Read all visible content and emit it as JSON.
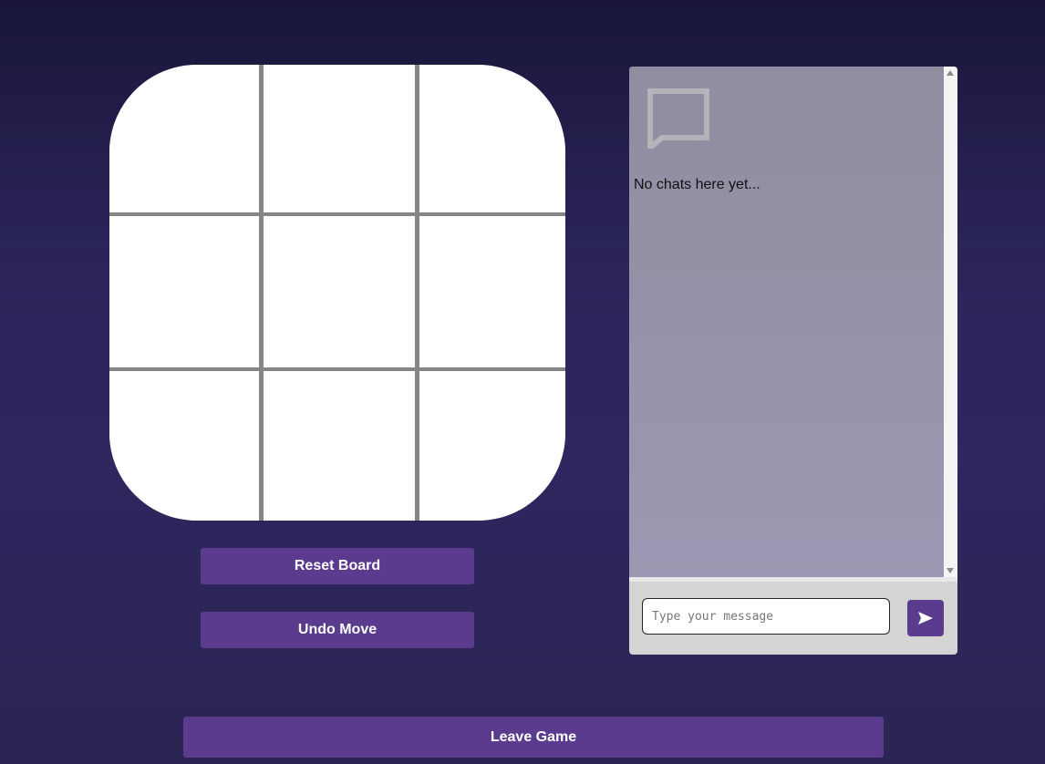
{
  "board": {
    "cells": [
      "",
      "",
      "",
      "",
      "",
      "",
      "",
      "",
      ""
    ]
  },
  "controls": {
    "reset_label": "Reset Board",
    "undo_label": "Undo Move",
    "leave_label": "Leave Game"
  },
  "chat": {
    "empty_message": "No chats here yet...",
    "input_placeholder": "Type your message",
    "input_value": "",
    "icon": "chat-bubble-icon",
    "send_icon": "send-icon"
  },
  "colors": {
    "accent": "#5a3b8e",
    "grid_lines": "#858585",
    "board": "#ffffff",
    "chat_log_bg": "#9592aa",
    "chat_footer_bg": "#d4d4d4"
  }
}
